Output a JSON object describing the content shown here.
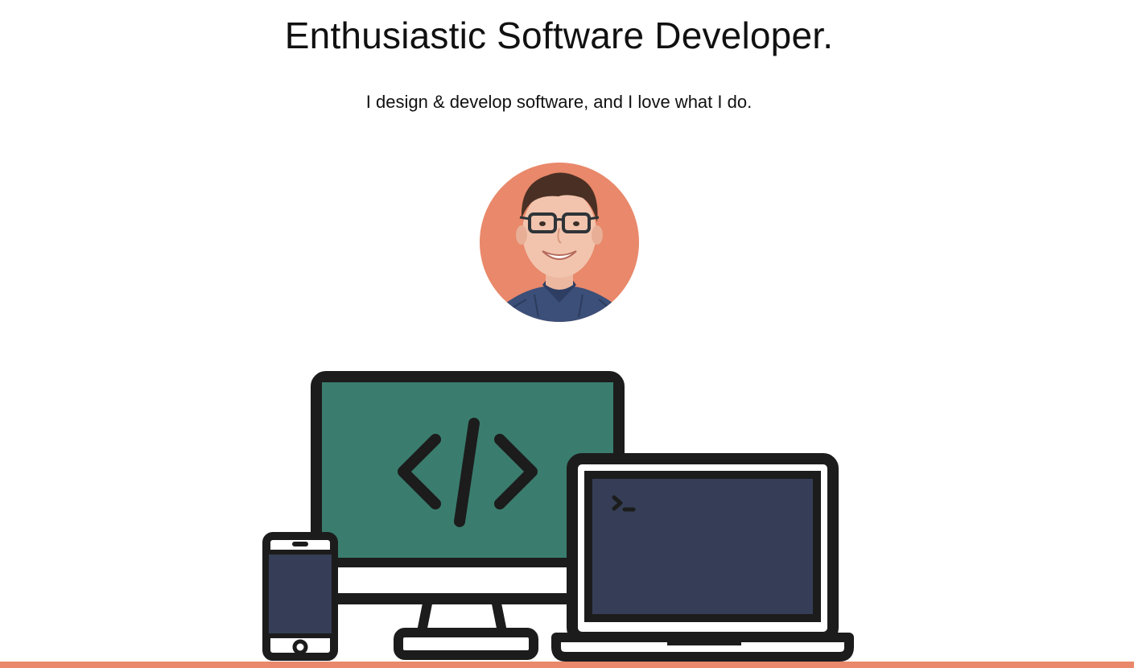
{
  "hero": {
    "title": "Enthusiastic Software Developer.",
    "subtitle": "I design & develop software, and I love what I do."
  },
  "avatar": {
    "description_icon": "profile-photo",
    "background_color": "#E9886A"
  },
  "illustration": {
    "icons": [
      "desktop-monitor-icon",
      "code-brackets-icon",
      "laptop-icon",
      "terminal-prompt-icon",
      "smartphone-icon"
    ],
    "colors": {
      "outline": "#1C1C1C",
      "monitor_screen": "#3A7D6E",
      "laptop_screen": "#353E56",
      "phone_screen": "#353E56",
      "body": "#FFFFFF"
    }
  },
  "footer_bar": {
    "color": "#E9886A"
  }
}
